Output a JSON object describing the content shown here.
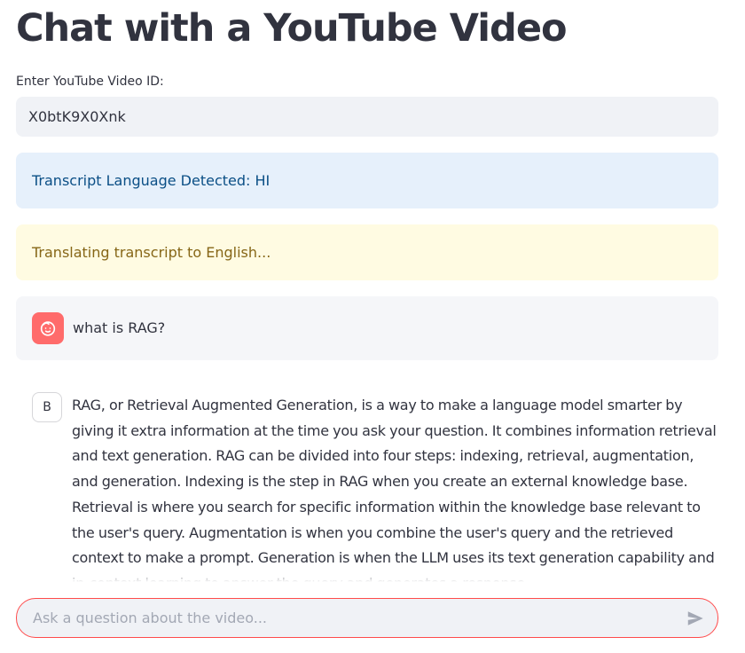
{
  "header": {
    "title": "Chat with a YouTube Video"
  },
  "video_input": {
    "label": "Enter YouTube Video ID:",
    "value": "X0btK9X0Xnk"
  },
  "alerts": {
    "info": "Transcript Language Detected: HI",
    "warning": "Translating transcript to English..."
  },
  "messages": {
    "user": {
      "avatar_icon": "smiley-face-icon",
      "text": "what is RAG?"
    },
    "assistant": {
      "avatar_letter": "B",
      "text": "RAG, or Retrieval Augmented Generation, is a way to make a language model smarter by giving it extra information at the time you ask your question. It combines information retrieval and text generation. RAG can be divided into four steps: indexing, retrieval, augmentation, and generation. Indexing is the step in RAG when you create an external knowledge base. Retrieval is where you search for specific information within the knowledge base relevant to the user's query. Augmentation is when you combine the user's query and the retrieved context to make a prompt. Generation is when the LLM uses its text generation capability and in-context learning to answer the query and generates a response."
    }
  },
  "chat_input": {
    "placeholder": "Ask a question about the video...",
    "send_icon": "send-arrow-icon"
  },
  "colors": {
    "info_bg": "#e6f0fb",
    "info_text": "#0b4f86",
    "warning_bg": "#fffbe2",
    "warning_text": "#866616",
    "user_avatar": "#ff6b6b",
    "accent_border": "#ff4b4b"
  }
}
